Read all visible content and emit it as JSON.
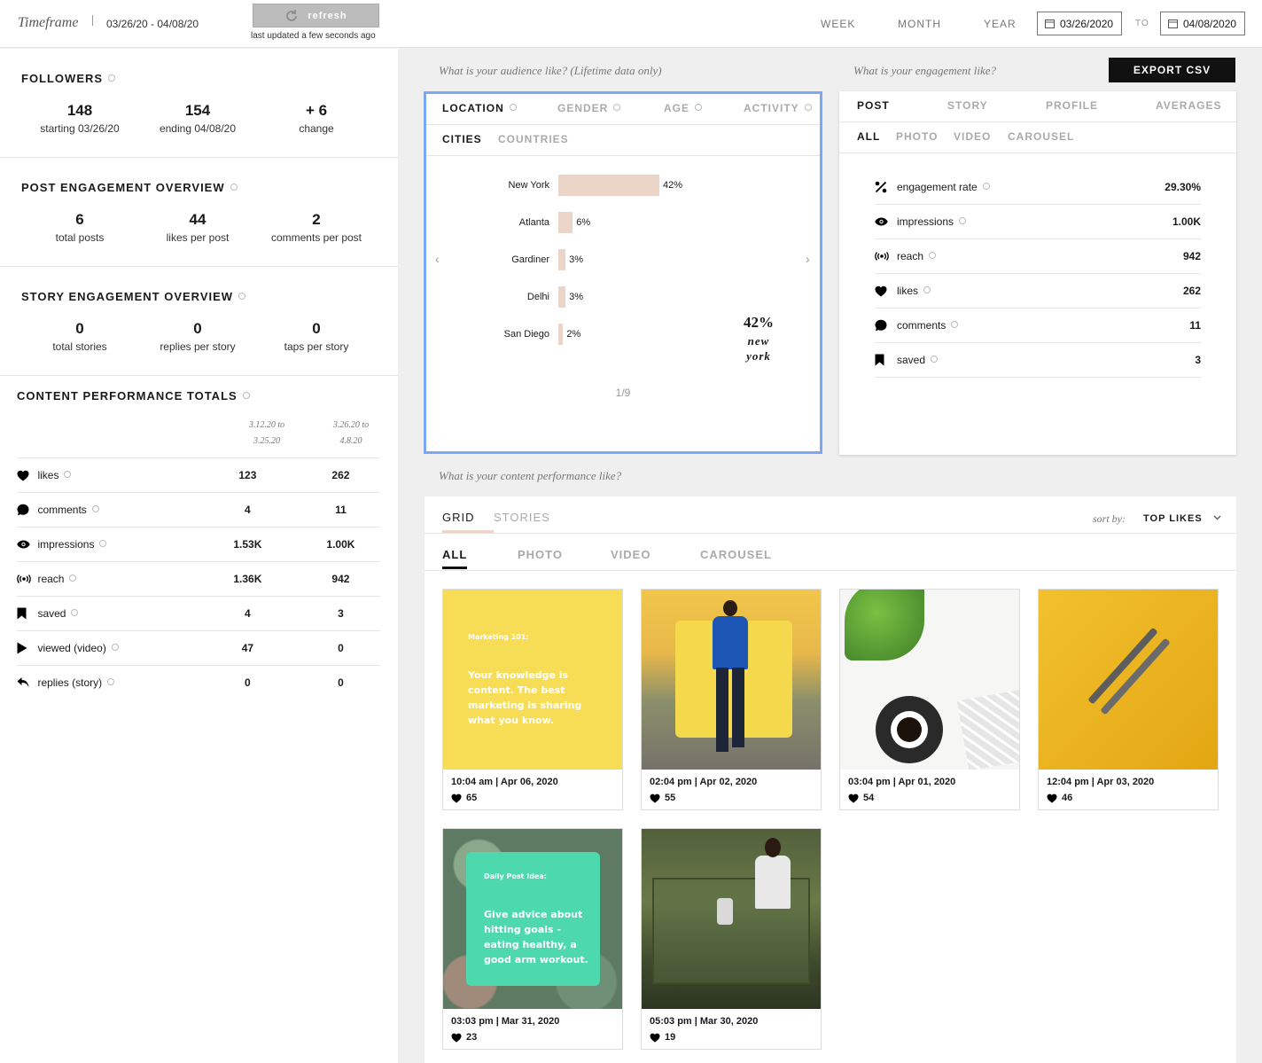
{
  "topbar": {
    "timeframe_label": "Timeframe",
    "range": "03/26/20 - 04/08/20",
    "refresh_label": "refresh",
    "last_updated": "last updated a few seconds ago",
    "periods": [
      "WEEK",
      "MONTH",
      "YEAR"
    ],
    "start_date": "03/26/2020",
    "to_label": "TO",
    "end_date": "04/08/2020"
  },
  "followers": {
    "title": "FOLLOWERS",
    "starting": {
      "value": "148",
      "label": "starting 03/26/20"
    },
    "ending": {
      "value": "154",
      "label": "ending 04/08/20"
    },
    "change": {
      "value": "+ 6",
      "label": "change"
    }
  },
  "post_engagement": {
    "title": "POST ENGAGEMENT OVERVIEW",
    "total_posts": {
      "value": "6",
      "label": "total posts"
    },
    "likes_per_post": {
      "value": "44",
      "label": "likes per post"
    },
    "comments_per_post": {
      "value": "2",
      "label": "comments per post"
    }
  },
  "story_engagement": {
    "title": "STORY ENGAGEMENT OVERVIEW",
    "total_stories": {
      "value": "0",
      "label": "total stories"
    },
    "replies_per_story": {
      "value": "0",
      "label": "replies per story"
    },
    "taps_per_story": {
      "value": "0",
      "label": "taps per story"
    }
  },
  "content_totals": {
    "title": "CONTENT PERFORMANCE TOTALS",
    "col1": "3.12.20 to 3.25.20",
    "col1_a": "3.12.20 to",
    "col1_b": "3.25.20",
    "col2_a": "3.26.20 to",
    "col2_b": "4.8.20",
    "rows": [
      {
        "icon": "heart-icon",
        "label": "likes",
        "prev": "123",
        "curr": "262"
      },
      {
        "icon": "comment-icon",
        "label": "comments",
        "prev": "4",
        "curr": "11"
      },
      {
        "icon": "eye-icon",
        "label": "impressions",
        "prev": "1.53K",
        "curr": "1.00K"
      },
      {
        "icon": "broadcast-icon",
        "label": "reach",
        "prev": "1.36K",
        "curr": "942"
      },
      {
        "icon": "bookmark-icon",
        "label": "saved",
        "prev": "4",
        "curr": "3"
      },
      {
        "icon": "play-icon",
        "label": "viewed (video)",
        "prev": "47",
        "curr": "0"
      },
      {
        "icon": "reply-icon",
        "label": "replies (story)",
        "prev": "0",
        "curr": "0"
      }
    ]
  },
  "audience": {
    "question": "What is your audience like? (Lifetime data only)",
    "tabs": [
      "LOCATION",
      "GENDER",
      "AGE",
      "ACTIVITY"
    ],
    "subtabs": [
      "CITIES",
      "COUNTRIES"
    ],
    "highlight_value": "42%",
    "highlight_line1": "new",
    "highlight_line2": "york",
    "pager": "1/9"
  },
  "chart_data": {
    "type": "bar",
    "categories": [
      "New York",
      "Atlanta",
      "Gardiner",
      "Delhi",
      "San Diego"
    ],
    "values": [
      42,
      6,
      3,
      3,
      2
    ],
    "value_labels": [
      "42%",
      "6%",
      "3%",
      "3%",
      "2%"
    ],
    "orientation": "horizontal",
    "color": "#ebd5c8"
  },
  "engagement": {
    "question": "What is your engagement like?",
    "export_label": "EXPORT CSV",
    "tabs": [
      "POST",
      "STORY",
      "PROFILE",
      "AVERAGES"
    ],
    "subtabs": [
      "ALL",
      "PHOTO",
      "VIDEO",
      "CAROUSEL"
    ],
    "metrics": [
      {
        "icon": "percent-icon",
        "label": "engagement rate",
        "value": "29.30%"
      },
      {
        "icon": "eye-icon",
        "label": "impressions",
        "value": "1.00K"
      },
      {
        "icon": "broadcast-icon",
        "label": "reach",
        "value": "942"
      },
      {
        "icon": "heart-icon",
        "label": "likes",
        "value": "262"
      },
      {
        "icon": "comment-icon",
        "label": "comments",
        "value": "11"
      },
      {
        "icon": "bookmark-icon",
        "label": "saved",
        "value": "3"
      }
    ]
  },
  "content": {
    "question": "What is your content performance like?",
    "tabs": [
      "GRID",
      "STORIES"
    ],
    "sort_label": "sort by:",
    "sort_value": "TOP LIKES",
    "subtabs": [
      "ALL",
      "PHOTO",
      "VIDEO",
      "CAROUSEL"
    ],
    "posts": [
      {
        "time": "10:04 am | Apr 06, 2020",
        "likes": "65",
        "kicker": "Marketing 101:",
        "text": "Your knowledge is content. The best marketing is sharing what you know."
      },
      {
        "time": "02:04 pm | Apr 02, 2020",
        "likes": "55"
      },
      {
        "time": "03:04 pm | Apr 01, 2020",
        "likes": "54"
      },
      {
        "time": "12:04 pm | Apr 03, 2020",
        "likes": "46"
      },
      {
        "time": "03:03 pm | Mar 31, 2020",
        "likes": "23",
        "kicker": "Daily Post Idea:",
        "text": "Give advice about hitting goals - eating healthy, a good arm workout."
      },
      {
        "time": "05:03 pm | Mar 30, 2020",
        "likes": "19"
      }
    ]
  },
  "colors": {
    "accent_border": "#7ea7f2",
    "bar": "#ebd5c8",
    "card_yellow": "#f7dd55",
    "card_teal": "#4dd9ad"
  }
}
